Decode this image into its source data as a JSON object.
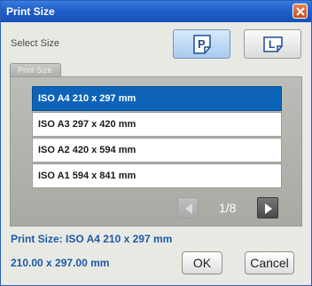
{
  "window": {
    "title": "Print Size"
  },
  "orientation": {
    "label": "Select Size",
    "portrait_glyph": "P",
    "landscape_glyph": "L",
    "selected": "portrait"
  },
  "tab": {
    "label": "Print Size"
  },
  "sizes": [
    {
      "label": "ISO A4 210 x 297 mm",
      "selected": true
    },
    {
      "label": "ISO A3 297 x 420 mm",
      "selected": false
    },
    {
      "label": "ISO A2 420 x 594 mm",
      "selected": false
    },
    {
      "label": "ISO A1 594 x 841 mm",
      "selected": false
    }
  ],
  "pagination": {
    "text": "1/8"
  },
  "info": {
    "print_size": "Print Size: ISO A4 210 x 297 mm",
    "dimensions": "210.00 x 297.00 mm"
  },
  "buttons": {
    "ok": "OK",
    "cancel": "Cancel"
  },
  "colors": {
    "accent": "#0d63b8",
    "text_blue": "#1b5aa6"
  }
}
